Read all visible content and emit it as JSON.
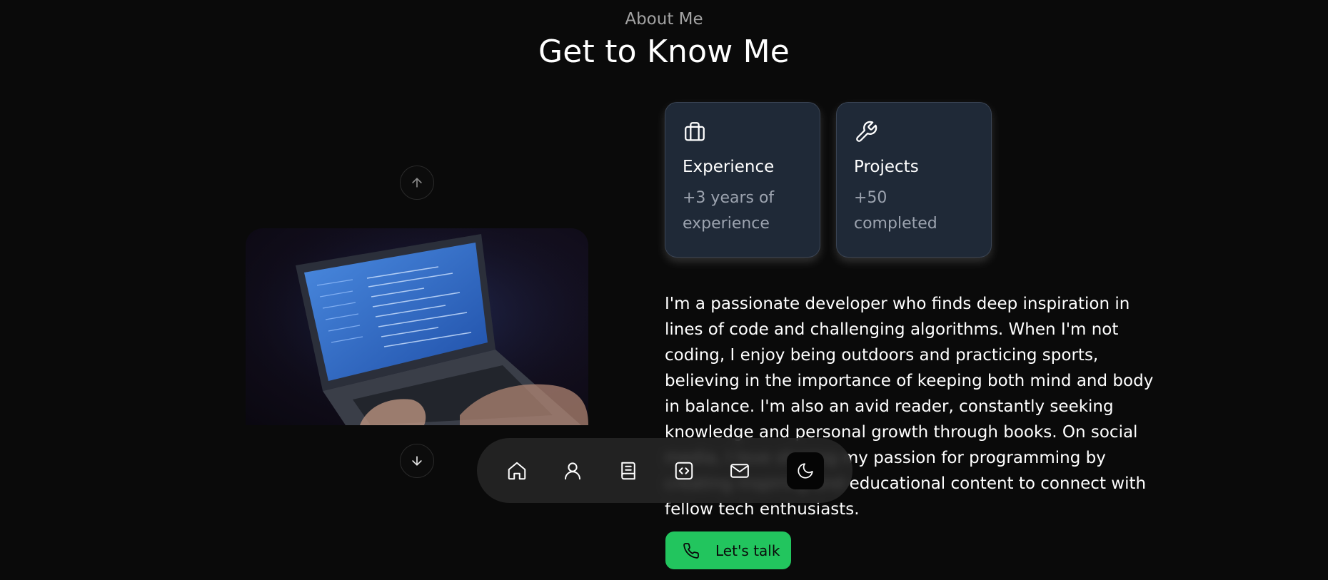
{
  "section": {
    "subtitle": "About Me",
    "title": "Get to Know Me"
  },
  "cards": [
    {
      "title": "Experience",
      "value": "+3 years of experience",
      "icon": "briefcase-icon"
    },
    {
      "title": "Projects",
      "value": "+50 completed",
      "icon": "wrench-icon"
    }
  ],
  "about": {
    "text": "I'm a passionate developer who finds deep inspiration in lines of code and challenging algorithms. When I'm not coding, I enjoy being outdoors and practicing sports, believing in the importance of keeping both mind and body in balance. I'm also an avid reader, constantly seeking knowledge and personal growth through books. On social media, I love sharing my passion for programming by creating inspiring and educational content to connect with fellow tech enthusiasts."
  },
  "cta": {
    "label": "Let's talk",
    "icon": "phone-icon"
  },
  "carousel": {
    "prev_icon": "arrow-up-icon",
    "next_icon": "arrow-down-icon"
  },
  "dock": {
    "items": [
      "home-icon",
      "user-icon",
      "book-icon",
      "code-icon",
      "mail-icon",
      "moon-icon"
    ],
    "active": "moon-icon"
  },
  "colors": {
    "background": "#0a0a0a",
    "card": "#1f2937",
    "accent": "#22c55e",
    "muted": "#9ca3af"
  }
}
